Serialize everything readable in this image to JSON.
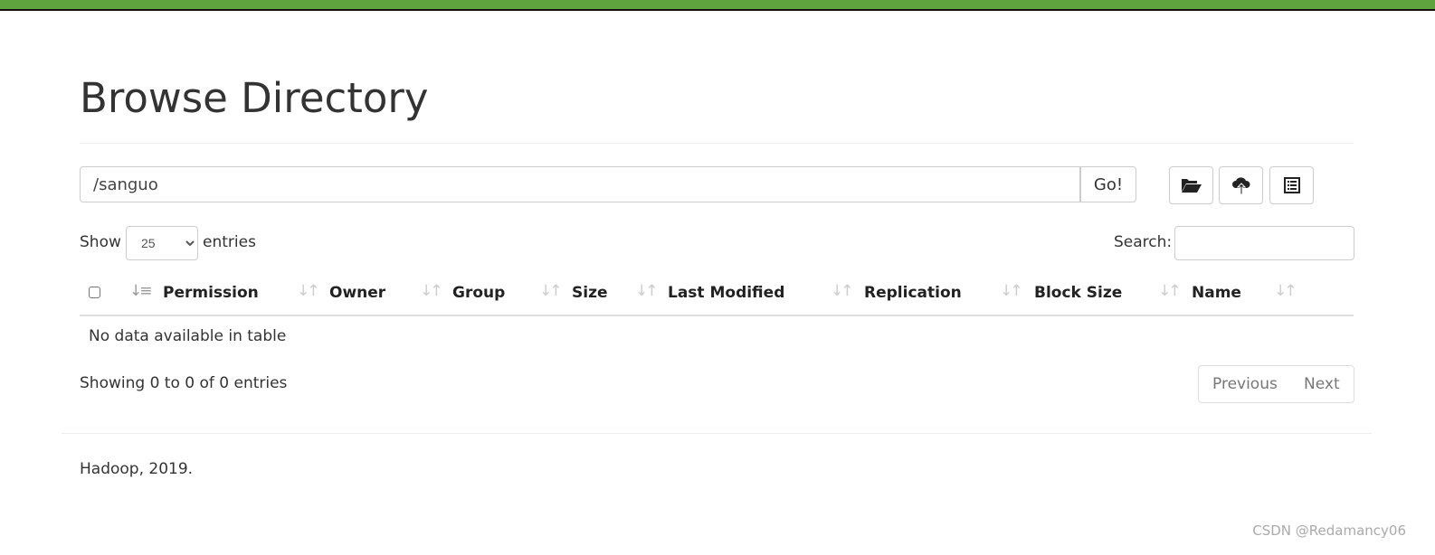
{
  "colors": {
    "topbar": "#5fa33e"
  },
  "title": "Browse Directory",
  "path_input": {
    "value": "/sanguo"
  },
  "go_label": "Go!",
  "toolbar_icons": [
    "folder-open-icon",
    "cloud-upload-icon",
    "list-icon"
  ],
  "show_label": "Show",
  "entries_label": "entries",
  "page_size": "25",
  "search_label": "Search:",
  "columns": [
    "Permission",
    "Owner",
    "Group",
    "Size",
    "Last Modified",
    "Replication",
    "Block Size",
    "Name"
  ],
  "empty_message": "No data available in table",
  "info": "Showing 0 to 0 of 0 entries",
  "pagination": {
    "previous": "Previous",
    "next": "Next"
  },
  "footer": "Hadoop, 2019.",
  "watermark": "CSDN @Redamancy06"
}
